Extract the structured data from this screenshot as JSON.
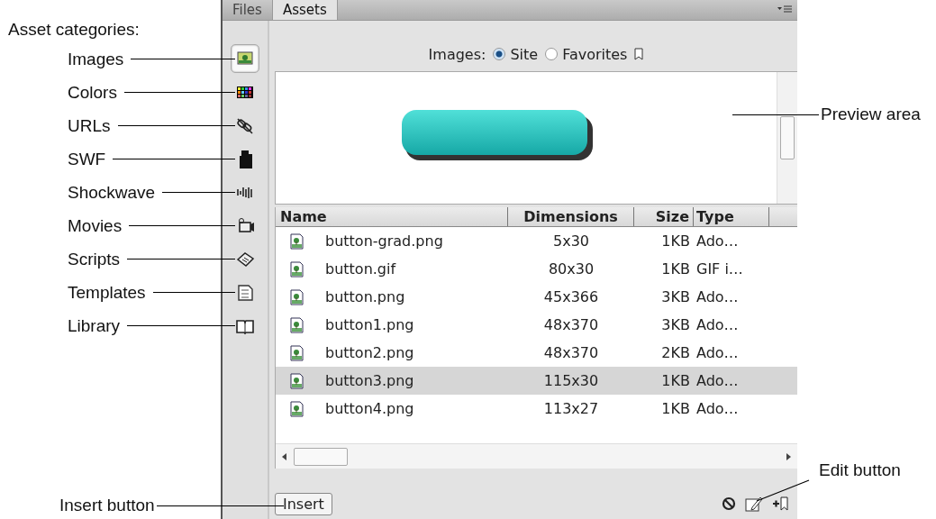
{
  "annotations": {
    "categories_title": "Asset categories:",
    "categories": [
      "Images",
      "Colors",
      "URLs",
      "SWF",
      "Shockwave",
      "Movies",
      "Scripts",
      "Templates",
      "Library"
    ],
    "preview": "Preview area",
    "edit": "Edit button",
    "insert": "Insert button"
  },
  "panel": {
    "tabs": [
      {
        "label": "Files",
        "selected": false
      },
      {
        "label": "Assets",
        "selected": true
      }
    ],
    "categories": [
      {
        "kind": "images",
        "selected": true
      },
      {
        "kind": "colors",
        "selected": false
      },
      {
        "kind": "urls",
        "selected": false
      },
      {
        "kind": "swf",
        "selected": false
      },
      {
        "kind": "shockwave",
        "selected": false
      },
      {
        "kind": "movies",
        "selected": false
      },
      {
        "kind": "scripts",
        "selected": false
      },
      {
        "kind": "templates",
        "selected": false
      },
      {
        "kind": "library",
        "selected": false
      }
    ],
    "filter": {
      "label": "Images:",
      "options": [
        {
          "label": "Site",
          "selected": true
        },
        {
          "label": "Favorites",
          "selected": false
        }
      ]
    },
    "columns": [
      "Name",
      "Dimensions",
      "Size",
      "Type"
    ],
    "rows": [
      {
        "name": "button-grad.png",
        "dimensions": "5x30",
        "size": "1KB",
        "type": "Ado…",
        "selected": false
      },
      {
        "name": "button.gif",
        "dimensions": "80x30",
        "size": "1KB",
        "type": "GIF i…",
        "selected": false
      },
      {
        "name": "button.png",
        "dimensions": "45x366",
        "size": "3KB",
        "type": "Ado…",
        "selected": false
      },
      {
        "name": "button1.png",
        "dimensions": "48x370",
        "size": "3KB",
        "type": "Ado…",
        "selected": false
      },
      {
        "name": "button2.png",
        "dimensions": "48x370",
        "size": "2KB",
        "type": "Ado…",
        "selected": false
      },
      {
        "name": "button3.png",
        "dimensions": "115x30",
        "size": "1KB",
        "type": "Ado…",
        "selected": true
      },
      {
        "name": "button4.png",
        "dimensions": "113x27",
        "size": "1KB",
        "type": "Ado…",
        "selected": false
      }
    ],
    "insert_button": "Insert"
  }
}
